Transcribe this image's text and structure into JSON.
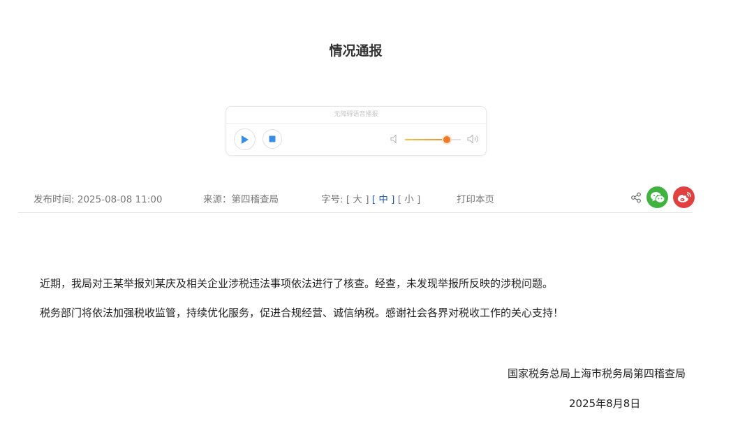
{
  "article": {
    "title": "情况通报",
    "paragraphs": [
      "近期，我局对王某举报刘某庆及相关企业涉税违法事项依法进行了核查。经查，未发现举报所反映的涉税问题。",
      "税务部门将依法加强税收监管，持续优化服务，促进合规经营、诚信纳税。感谢社会各界对税收工作的关心支持！"
    ],
    "signature_org": "国家税务总局上海市税务局第四稽查局",
    "signature_date": "2025年8月8日"
  },
  "player": {
    "header_label": "无障碍语音播报",
    "volume_level": 0.75,
    "icons": [
      "play-icon",
      "stop-icon",
      "volume-low-icon",
      "volume-high-icon"
    ]
  },
  "meta": {
    "publish_label": "发布时间:",
    "publish_value": "2025-08-08 11:00",
    "source_label": "来源：第四稽查局",
    "fontsize_label": "字号:",
    "fontsize_options": [
      "[ 大 ]",
      "[ 中 ]",
      "[ 小 ]"
    ],
    "fontsize_selected": "中",
    "print_label": "打印本页",
    "icons": [
      "share-icon",
      "wechat-icon",
      "weibo-icon"
    ]
  },
  "colors": {
    "accent_orange": "#f07a2a",
    "selected_blue": "#1f5aa8",
    "wechat_green": "#3fb23f",
    "weibo_red": "#e0403f"
  }
}
